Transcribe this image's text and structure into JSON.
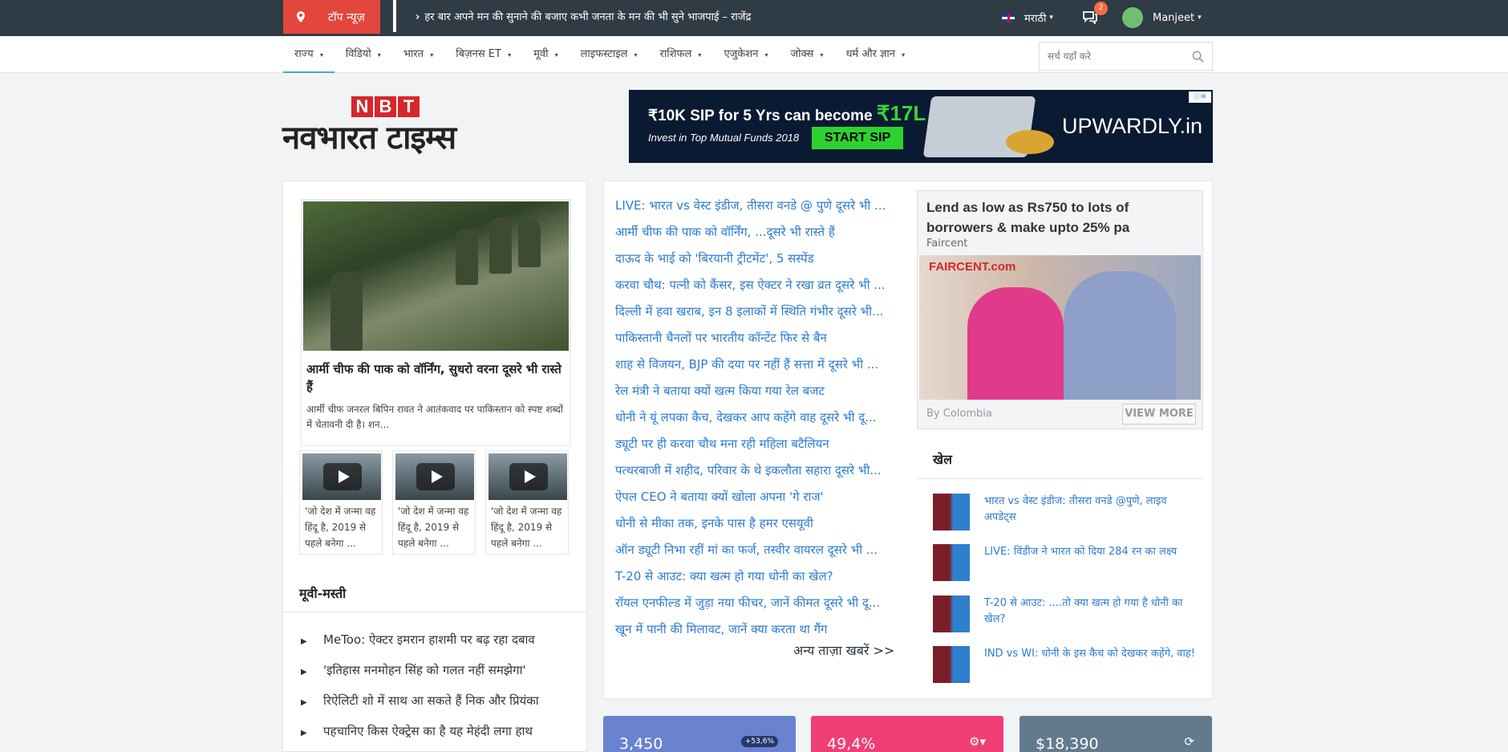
{
  "topbar": {
    "top_news_label": "टॉप न्यूज़",
    "ticker_text": "हर बार अपने मन की सुनाने की बजाए कभी जनता के मन की भी सुने भाजपाई – राजेंद्र",
    "language": "मराठी",
    "message_count": "2",
    "user_name": "Manjeet"
  },
  "nav": {
    "items": [
      "राज्य",
      "विडियो",
      "भारत",
      "बिज़नस ET",
      "मूवी",
      "लाइफस्टाइल",
      "राशिफल",
      "एजुकेशन",
      "जोक्स",
      "धर्म और ज्ञान"
    ],
    "search_placeholder": "सर्च यहाँ करे"
  },
  "logo": {
    "badge_letters": [
      "N",
      "B",
      "T"
    ],
    "name": "नवभारत टाइम्स"
  },
  "ad_top": {
    "line1_prefix": "₹10K SIP for 5 Yrs can become ",
    "line1_amount": "₹17L",
    "line2": "Invest in Top Mutual Funds 2018",
    "cta": "START SIP",
    "brand": "UPWARDLY.in"
  },
  "featured": {
    "title": "आर्मी चीफ की पाक को वॉर्निंग, सुधरो वरना दूसरे भी रास्ते हैं",
    "description": "आर्मी चीफ जनरल बिपिन रावत ने आतंकवाद पर पाकिस्तान को स्पष्ट शब्दों में चेतावनी दी है। शन..."
  },
  "videos": [
    {
      "caption": "'जो देश में जन्मा वह हिंदू है, 2019 से पहले बनेगा ..."
    },
    {
      "caption": "'जो देश में जन्मा वह हिंदू है, 2019 से पहले बनेगा ..."
    },
    {
      "caption": "'जो देश में जन्मा वह हिंदू है, 2019 से पहले बनेगा ..."
    }
  ],
  "movie_section": {
    "title": "मूवी-मस्ती",
    "items": [
      "MeToo: ऐक्टर इमरान हाशमी पर बढ़ रहा दबाव",
      "'इतिहास मनमोहन सिंह को गलत नहीं समझेगा'",
      "रिऐलिटी शो में साथ आ सकते हैं निक और प्रियंका",
      "पहचानिए किस ऐक्ट्रेस का है यह मेहंदी लगा हाथ"
    ]
  },
  "news_list": [
    "LIVE: भारत vs वेस्ट इंडीज, तीसरा वनडे @ पुणे दूसरे भी ...",
    "आर्मी चीफ की पाक को वॉर्निंग, ...दूसरे भी रास्ते हैं",
    "दाऊद के भाई को 'बिरयानी ट्रीटमेंट', 5 सस्पेंड",
    "करवा चौथ: पत्नी को कैंसर, इस ऐक्टर ने रखा व्रत दूसरे भी ...",
    "दिल्ली में हवा खराब, इन 8 इलाकों में स्थिति गंभीर दूसरे भी...",
    "पाकिस्तानी चैनलों पर भारतीय कॉन्टेंट फिर से बैन",
    "शाह से विजयन, BJP की दया पर नहीं हैं सत्ता में दूसरे भी ...",
    "रेल मंत्री ने बताया क्यों खत्म किया गया रेल बजट",
    "धोनी ने यूं लपका कैच, देखकर आप कहेंगे वाह दूसरे भी दू...",
    "ड्यूटी पर ही करवा चौथ मना रही महिला बटैलियन",
    "पत्थरबाजी में शहीद, परिवार के थे इकलौता सहारा दूसरे भी...",
    "ऐपल CEO ने बताया क्यों खोला अपना 'गे राज'",
    "धोनी से मीका तक, इनके पास है हमर एसयूवी",
    "ऑन ड्यूटी निभा रहीं मां का फर्ज, तस्वीर वायरल दूसरे भी ...",
    "T-20 से आउट: क्या खत्म हो गया धोनी का खेल?",
    "रॉयल एनफील्ड में जुड़ा नया फीचर, जानें कीमत दूसरे भी दू...",
    "खून में पानी की मिलावट, जानें क्या करता था गैंग"
  ],
  "more_news_label": "अन्य ताज़ा खबरें >>",
  "ad_box": {
    "headline": "Lend as low as Rs750 to lots of borrowers & make upto 25% pa",
    "source": "Faircent",
    "logo_text": "FAIRCENT.com",
    "by": "By Colombia",
    "cta": "VIEW MORE"
  },
  "khel": {
    "title": "खेल",
    "items": [
      "भारत vs वेस्ट इंडीज: तीसरा वनडे @पुणे, लाइव अपडेट्स",
      "LIVE: विंडीज ने भारत को दिया 284 रन का लक्ष्य",
      "T-20 से आउट: ....तो क्या खत्म हो गया है धोनी का खेल?",
      "IND vs WI: धोनी के इस कैच को देखकर कहेंगे, वाह!"
    ]
  },
  "cards": [
    {
      "value": "3,450",
      "badge": "+53,6%"
    },
    {
      "value": "49,4%",
      "icon": "gear-icon"
    },
    {
      "value": "$18,390",
      "icon": "refresh-icon"
    }
  ]
}
